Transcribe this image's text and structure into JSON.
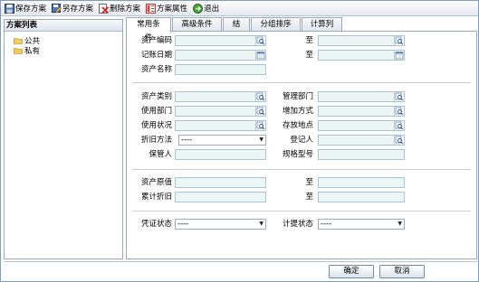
{
  "toolbar": {
    "items": [
      {
        "label": "保存方案",
        "icon": "save-icon"
      },
      {
        "label": "另存方案",
        "icon": "save-as-icon"
      },
      {
        "label": "删除方案",
        "icon": "delete-icon"
      },
      {
        "label": "方案属性",
        "icon": "properties-icon"
      },
      {
        "label": "退出",
        "icon": "exit-icon"
      }
    ]
  },
  "left": {
    "title": "方案列表",
    "tree": [
      {
        "label": "公共",
        "icon": "folder-icon"
      },
      {
        "label": "私有",
        "icon": "folder-icon"
      }
    ]
  },
  "tabs": [
    "常用条件",
    "高级条件",
    "结果",
    "分组排序",
    "计算列"
  ],
  "form": {
    "asset_code": "资产编码",
    "entry_date": "记账日期",
    "asset_name": "资产名称",
    "to": "至",
    "asset_category": "资产类别",
    "manage_dept": "管理部门",
    "use_dept": "使用部门",
    "add_method": "增加方式",
    "use_status": "使用状况",
    "location": "存放地点",
    "depr_method": "折旧方法",
    "depr_method_value": "----",
    "registrar": "登记人",
    "custodian": "保管人",
    "spec_model": "规格型号",
    "original_value": "资产原值",
    "accum_depr": "累计折旧",
    "voucher_status": "凭证状态",
    "voucher_status_value": "----",
    "accrual_status": "计提状态",
    "accrual_status_value": "----"
  },
  "buttons": {
    "ok": "确定",
    "cancel": "取消"
  },
  "colors": {
    "field_bg": "#ecf7f5",
    "field_border": "#a5c4d8"
  }
}
